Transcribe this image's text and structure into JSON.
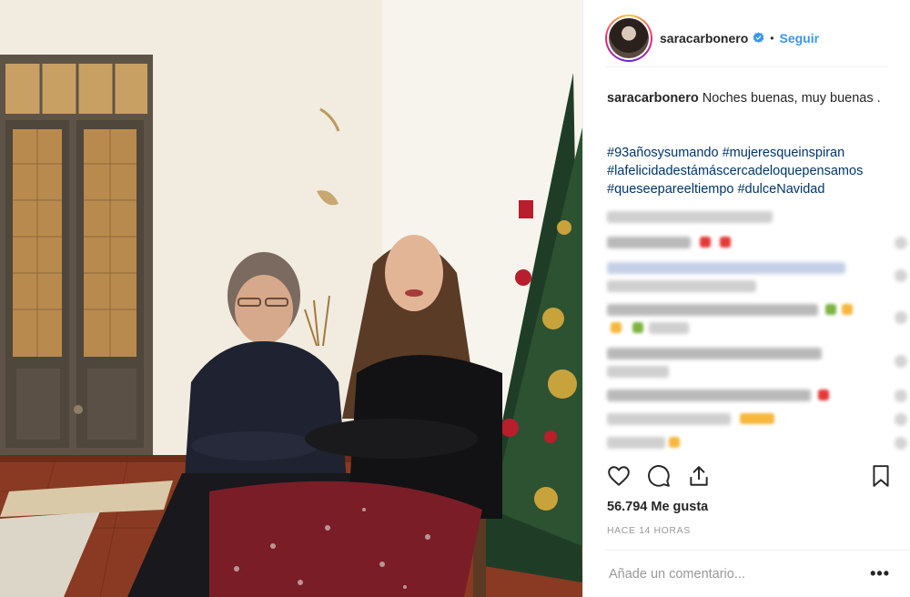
{
  "post": {
    "username": "saracarbonero",
    "separator": "•",
    "follow_label": "Seguir",
    "caption_user": "saracarbonero",
    "caption_text": " Noches buenas, muy buenas .",
    "hashtags": [
      "#93añosysumando #mujeresqueinspiran",
      "#lafelicidadestámáscercadeloquepensamos",
      "#queseepareeltiempo #dulceNavidad"
    ],
    "likes": "56.794 Me gusta",
    "timestamp": "HACE 14 HORAS",
    "comment_placeholder": "Añade un comentario...",
    "more_label": "•••"
  },
  "icons": {
    "avatar": "profile-photo",
    "verified": "verified-badge-icon",
    "like": "heart-icon",
    "comment": "comment-bubble-icon",
    "share": "share-icon",
    "save": "bookmark-icon",
    "more": "ellipsis-icon"
  },
  "colors": {
    "link": "#3897f0",
    "hashtag": "#003569",
    "text": "#262626",
    "muted": "#999999",
    "border": "#efefef"
  }
}
